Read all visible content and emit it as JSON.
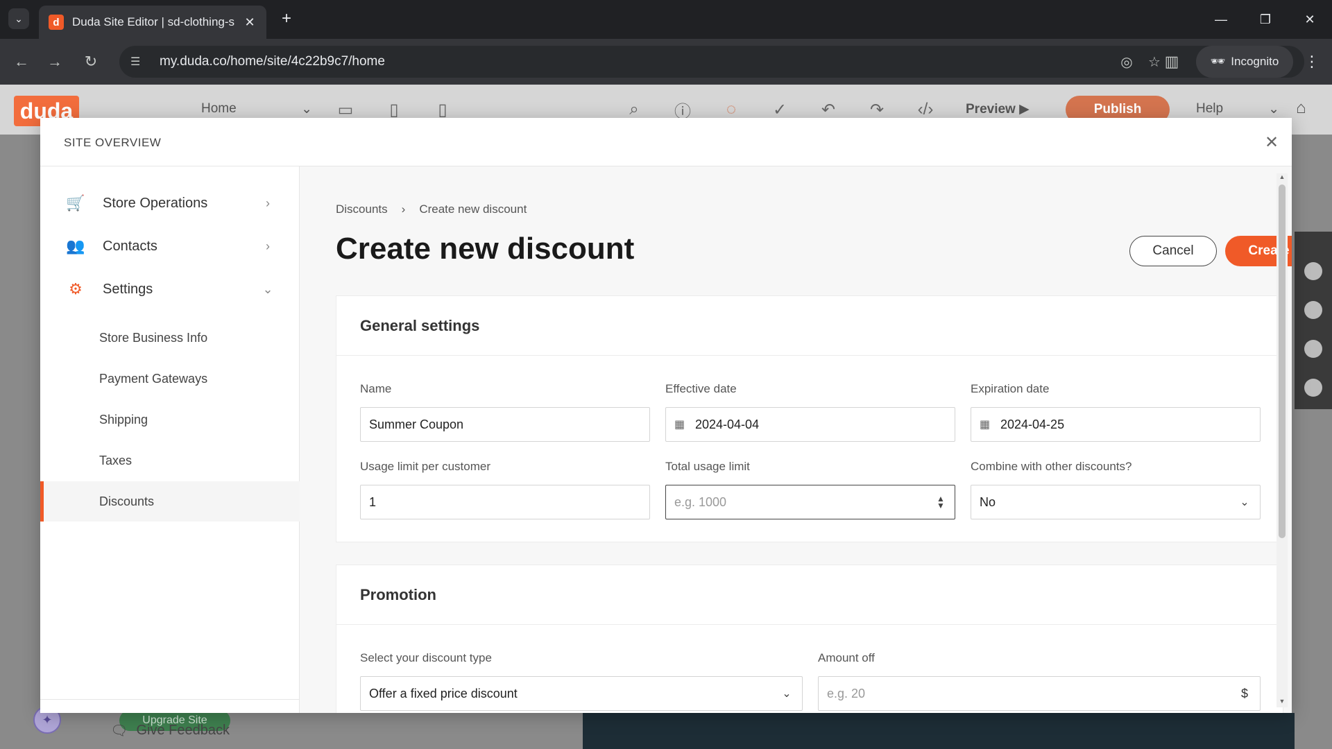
{
  "browser": {
    "tab_title": "Duda Site Editor | sd-clothing-s",
    "tab_favicon": "d",
    "url": "my.duda.co/home/site/4c22b9c7/home",
    "incognito_label": "Incognito"
  },
  "editor_toolbar": {
    "logo": "duda",
    "page_selector": "Home",
    "preview_label": "Preview",
    "publish_label": "Publish",
    "help_label": "Help",
    "upgrade_label": "Upgrade Site"
  },
  "modal": {
    "title": "SITE OVERVIEW",
    "sidebar": {
      "items": [
        {
          "label": "Store Operations",
          "icon": "cart-icon"
        },
        {
          "label": "Contacts",
          "icon": "contacts-icon"
        },
        {
          "label": "Settings",
          "icon": "gear-icon"
        }
      ],
      "sub_items": [
        {
          "label": "Store Business Info"
        },
        {
          "label": "Payment Gateways"
        },
        {
          "label": "Shipping"
        },
        {
          "label": "Taxes"
        },
        {
          "label": "Discounts",
          "active": true
        }
      ],
      "feedback_label": "Give Feedback"
    },
    "breadcrumb": {
      "parent": "Discounts",
      "current": "Create new discount"
    },
    "page_title": "Create new discount",
    "cancel_label": "Cancel",
    "create_label": "Create",
    "general": {
      "heading": "General settings",
      "name_label": "Name",
      "name_value": "Summer Coupon",
      "effective_label": "Effective date",
      "effective_value": "2024-04-04",
      "expiration_label": "Expiration date",
      "expiration_value": "2024-04-25",
      "usage_customer_label": "Usage limit per customer",
      "usage_customer_value": "1",
      "total_usage_label": "Total usage limit",
      "total_usage_placeholder": "e.g. 1000",
      "combine_label": "Combine with other discounts?",
      "combine_value": "No"
    },
    "promotion": {
      "heading": "Promotion",
      "type_label": "Select your discount type",
      "type_value": "Offer a fixed price discount",
      "amount_label": "Amount off",
      "amount_placeholder": "e.g. 20",
      "amount_suffix": "$"
    }
  },
  "colors": {
    "accent": "#f05a28",
    "active_bar": "#f05a28"
  }
}
